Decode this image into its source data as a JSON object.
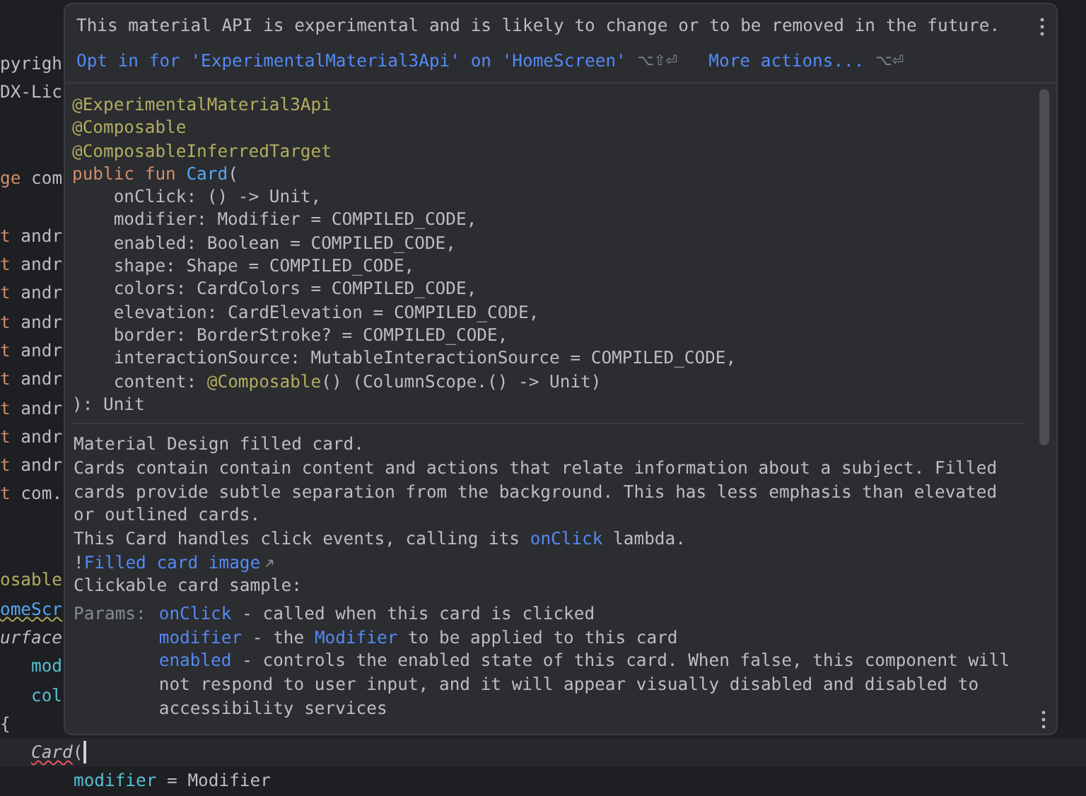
{
  "editor": {
    "lines": [
      {
        "kind": "code",
        "current": false,
        "segments": [
          {
            "text": "pyrigh",
            "kind": "comment"
          }
        ]
      },
      {
        "kind": "code",
        "current": false,
        "segments": [
          {
            "text": "DX-Lic",
            "kind": "comment"
          }
        ]
      },
      {
        "kind": "blank"
      },
      {
        "kind": "blank"
      },
      {
        "kind": "code",
        "current": false,
        "segments": [
          {
            "text": "ge",
            "kind": "keyword"
          },
          {
            "text": " com",
            "kind": "plain"
          }
        ]
      },
      {
        "kind": "blank"
      },
      {
        "kind": "code",
        "current": false,
        "segments": [
          {
            "text": "t",
            "kind": "keyword"
          },
          {
            "text": " andr",
            "kind": "plain"
          }
        ]
      },
      {
        "kind": "code",
        "current": false,
        "segments": [
          {
            "text": "t",
            "kind": "keyword"
          },
          {
            "text": " andr",
            "kind": "plain"
          }
        ]
      },
      {
        "kind": "code",
        "current": false,
        "segments": [
          {
            "text": "t",
            "kind": "keyword"
          },
          {
            "text": " andr",
            "kind": "plain"
          }
        ]
      },
      {
        "kind": "code",
        "current": false,
        "segments": [
          {
            "text": "t",
            "kind": "keyword"
          },
          {
            "text": " andr",
            "kind": "plain"
          }
        ]
      },
      {
        "kind": "code",
        "current": false,
        "segments": [
          {
            "text": "t",
            "kind": "keyword"
          },
          {
            "text": " andr",
            "kind": "plain"
          }
        ]
      },
      {
        "kind": "code",
        "current": false,
        "segments": [
          {
            "text": "t",
            "kind": "keyword"
          },
          {
            "text": " andr",
            "kind": "plain"
          }
        ]
      },
      {
        "kind": "code",
        "current": false,
        "segments": [
          {
            "text": "t",
            "kind": "keyword"
          },
          {
            "text": " andr",
            "kind": "plain"
          }
        ]
      },
      {
        "kind": "code",
        "current": false,
        "segments": [
          {
            "text": "t",
            "kind": "keyword"
          },
          {
            "text": " andr",
            "kind": "plain"
          }
        ]
      },
      {
        "kind": "code",
        "current": false,
        "segments": [
          {
            "text": "t",
            "kind": "keyword"
          },
          {
            "text": " andr",
            "kind": "plain"
          }
        ]
      },
      {
        "kind": "code",
        "current": false,
        "segments": [
          {
            "text": "t",
            "kind": "keyword"
          },
          {
            "text": " com.",
            "kind": "plain"
          }
        ]
      },
      {
        "kind": "blank"
      },
      {
        "kind": "blank"
      },
      {
        "kind": "code",
        "current": false,
        "segments": [
          {
            "text": "osable",
            "kind": "annotation"
          }
        ]
      },
      {
        "kind": "code",
        "current": false,
        "segments": [
          {
            "text": "omeScr",
            "kind": "warning-function"
          }
        ]
      },
      {
        "kind": "code",
        "current": false,
        "segments": [
          {
            "text": "urface",
            "kind": "italic"
          }
        ]
      },
      {
        "kind": "code",
        "current": false,
        "segments": [
          {
            "text": "   mod",
            "kind": "param"
          }
        ]
      },
      {
        "kind": "code",
        "current": false,
        "segments": [
          {
            "text": "   col",
            "kind": "param"
          }
        ]
      },
      {
        "kind": "code",
        "current": false,
        "segments": [
          {
            "text": "{",
            "kind": "plain"
          }
        ],
        "children": [
          {
            "kind": "code",
            "current": true,
            "segments": [
              {
                "text": "Card",
                "kind": "error-italic"
              },
              {
                "text": "(",
                "kind": "plain"
              }
            ],
            "children": [
              {
                "kind": "code",
                "current": false,
                "segments": [
                  {
                    "text": "modifier",
                    "kind": "param"
                  },
                  {
                    "text": " = Modifier",
                    "kind": "plain"
                  }
                ]
              }
            ]
          }
        ]
      }
    ]
  },
  "popup": {
    "message": "This material API is experimental and is likely to change or to be removed in the future.",
    "actions": [
      {
        "label": "Opt in for 'ExperimentalMaterial3Api' on 'HomeScreen'",
        "shortcut": "⌥⇧⏎"
      },
      {
        "label": "More actions...",
        "shortcut": "⌥⏎"
      }
    ],
    "signature": [
      [
        {
          "text": "@ExperimentalMaterial3Api",
          "kind": "annotation"
        }
      ],
      [
        {
          "text": "@Composable",
          "kind": "annotation"
        }
      ],
      [
        {
          "text": "@ComposableInferredTarget",
          "kind": "annotation"
        }
      ],
      [
        {
          "text": "public fun ",
          "kind": "keyword"
        },
        {
          "text": "Card",
          "kind": "function"
        },
        {
          "text": "(",
          "kind": "plain"
        }
      ],
      [
        {
          "text": "    onClick: () -> Unit,",
          "kind": "plain"
        }
      ],
      [
        {
          "text": "    modifier: Modifier = COMPILED_CODE,",
          "kind": "plain"
        }
      ],
      [
        {
          "text": "    enabled: Boolean = COMPILED_CODE,",
          "kind": "plain"
        }
      ],
      [
        {
          "text": "    shape: Shape = COMPILED_CODE,",
          "kind": "plain"
        }
      ],
      [
        {
          "text": "    colors: CardColors = COMPILED_CODE,",
          "kind": "plain"
        }
      ],
      [
        {
          "text": "    elevation: CardElevation = COMPILED_CODE,",
          "kind": "plain"
        }
      ],
      [
        {
          "text": "    border: BorderStroke? = COMPILED_CODE,",
          "kind": "plain"
        }
      ],
      [
        {
          "text": "    interactionSource: MutableInteractionSource = COMPILED_CODE,",
          "kind": "plain"
        }
      ],
      [
        {
          "text": "    content: ",
          "kind": "plain"
        },
        {
          "text": "@Composable",
          "kind": "annotation"
        },
        {
          "text": "() (ColumnScope.() -> Unit)",
          "kind": "plain"
        }
      ],
      [
        {
          "text": "): Unit",
          "kind": "plain"
        }
      ]
    ],
    "docs": [
      [
        {
          "text": "Material Design filled card.",
          "kind": "plain"
        }
      ],
      [
        {
          "text": "Cards contain contain content and actions that relate information about a subject. Filled cards provide subtle separation from the background. This has less emphasis than elevated or outlined cards.",
          "kind": "plain"
        }
      ],
      [
        {
          "text": "This Card handles click events, calling its ",
          "kind": "plain"
        },
        {
          "text": "onClick",
          "kind": "link"
        },
        {
          "text": " lambda.",
          "kind": "plain"
        }
      ],
      [
        {
          "text": "!",
          "kind": "plain"
        },
        {
          "text": "Filled card image",
          "kind": "external-link"
        }
      ],
      [
        {
          "text": "Clickable card sample:",
          "kind": "plain"
        }
      ]
    ],
    "params_label": "Params:",
    "params": [
      [
        {
          "text": "onClick",
          "kind": "link"
        },
        {
          "text": " - called when this card is clicked",
          "kind": "plain"
        }
      ],
      [
        {
          "text": "modifier",
          "kind": "link"
        },
        {
          "text": " - the ",
          "kind": "plain"
        },
        {
          "text": "Modifier",
          "kind": "link"
        },
        {
          "text": " to be applied to this card",
          "kind": "plain"
        }
      ],
      [
        {
          "text": "enabled",
          "kind": "link"
        },
        {
          "text": " - controls the enabled state of this card. When false, this component will not respond to user input, and it will appear visually disabled and disabled to accessibility services",
          "kind": "plain"
        }
      ]
    ]
  }
}
